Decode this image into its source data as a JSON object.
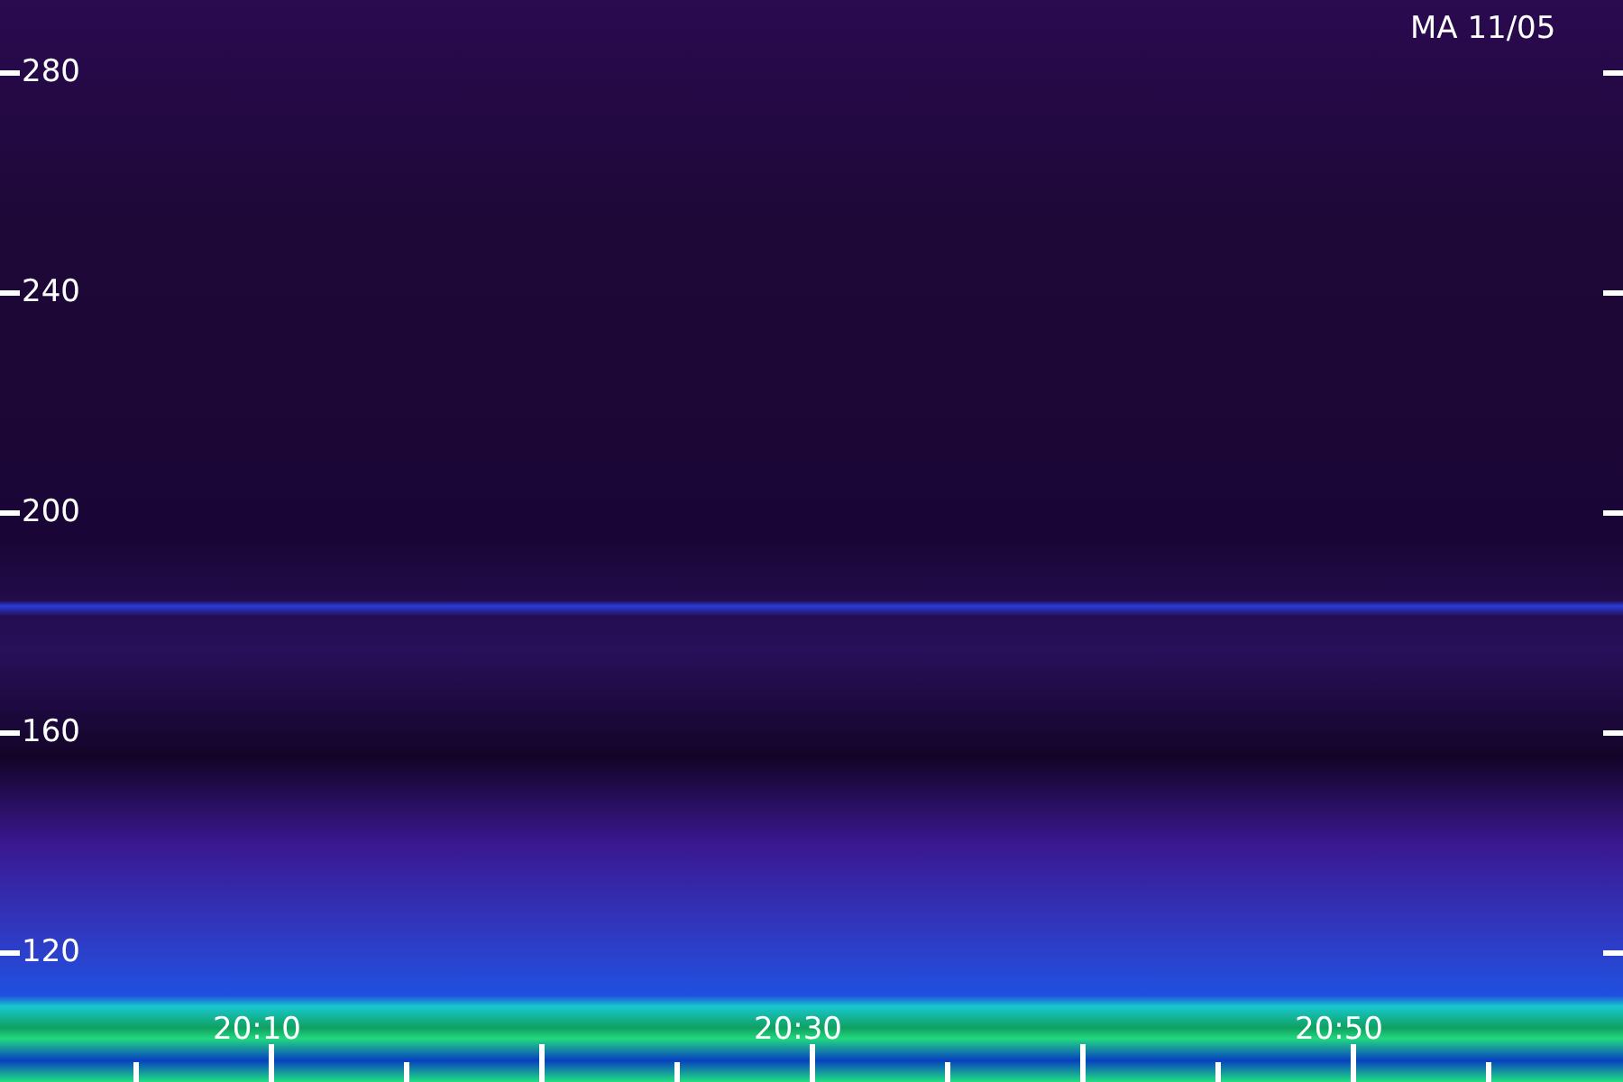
{
  "title": "MA 11/05",
  "y_axis": {
    "ticks": [
      "280",
      "240",
      "200",
      "160",
      "120"
    ]
  },
  "x_axis": {
    "ticks": [
      "20:10",
      "20:30",
      "20:50"
    ]
  }
}
